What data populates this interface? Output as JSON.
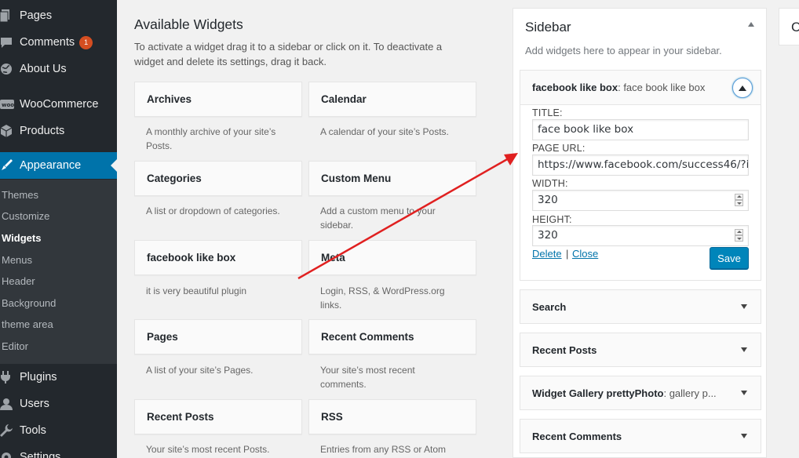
{
  "admin_menu": {
    "items": [
      {
        "label": "Pages",
        "icon": "pages-icon"
      },
      {
        "label": "Comments",
        "icon": "comments-icon",
        "badge": "1"
      },
      {
        "label": "About Us",
        "icon": "about-icon"
      },
      {
        "label": "WooCommerce",
        "icon": "woocommerce-icon"
      },
      {
        "label": "Products",
        "icon": "products-icon"
      },
      {
        "label": "Appearance",
        "icon": "appearance-icon"
      },
      {
        "label": "Plugins",
        "icon": "plugins-icon"
      },
      {
        "label": "Users",
        "icon": "users-icon"
      },
      {
        "label": "Tools",
        "icon": "tools-icon"
      },
      {
        "label": "Settings",
        "icon": "settings-icon"
      }
    ],
    "submenu": [
      "Themes",
      "Customize",
      "Widgets",
      "Menus",
      "Header",
      "Background",
      "theme area",
      "Editor"
    ],
    "current_submenu": "Widgets",
    "current_item": "Appearance"
  },
  "available": {
    "title": "Available Widgets",
    "description_line1": "To activate a widget drag it to a sidebar or click on it. To deactivate a",
    "description_line2": "widget and delete its settings, drag it back.",
    "widgets": [
      {
        "title": "Archives",
        "desc1": "A monthly archive of your site’s",
        "desc2": "Posts."
      },
      {
        "title": "Calendar",
        "desc1": "A calendar of your site’s Posts.",
        "desc2": ""
      },
      {
        "title": "Categories",
        "desc1": "A list or dropdown of categories.",
        "desc2": ""
      },
      {
        "title": "Custom Menu",
        "desc1": "Add a custom menu to your",
        "desc2": "sidebar."
      },
      {
        "title": "facebook like box",
        "desc1": "it is very beautiful plugin",
        "desc2": ""
      },
      {
        "title": "Meta",
        "desc1": "Login, RSS, & WordPress.org",
        "desc2": "links."
      },
      {
        "title": "Pages",
        "desc1": "A list of your site’s Pages.",
        "desc2": ""
      },
      {
        "title": "Recent Comments",
        "desc1": "Your site’s most recent",
        "desc2": "comments."
      },
      {
        "title": "Recent Posts",
        "desc1": "Your site’s most recent Posts.",
        "desc2": ""
      },
      {
        "title": "RSS",
        "desc1": "Entries from any RSS or Atom",
        "desc2": ""
      }
    ]
  },
  "sidebar": {
    "title": "Sidebar",
    "description": "Add widgets here to appear in your sidebar.",
    "open_widget": {
      "name": "facebook like box",
      "subtitle": ": face book like box",
      "fields": {
        "title_label": "TITLE:",
        "title_value": "face book like box",
        "url_label": "PAGE URL:",
        "url_value": "https://www.facebook.com/success46/?i",
        "width_label": "WIDTH:",
        "width_value": "320",
        "height_label": "HEIGHT:",
        "height_value": "320"
      },
      "delete_label": "Delete",
      "separator": "|",
      "close_label": "Close",
      "save_label": "Save"
    },
    "widgets": [
      {
        "name": "Search",
        "subtitle": ""
      },
      {
        "name": "Recent Posts",
        "subtitle": ""
      },
      {
        "name": "Widget Gallery prettyPhoto",
        "subtitle": ": gallery p..."
      },
      {
        "name": "Recent Comments",
        "subtitle": ""
      }
    ]
  },
  "far_right": {
    "title_fragment": "C"
  },
  "colors": {
    "admin_bg": "#23282d",
    "accent": "#0073aa",
    "annotation_arrow": "#e02020"
  }
}
